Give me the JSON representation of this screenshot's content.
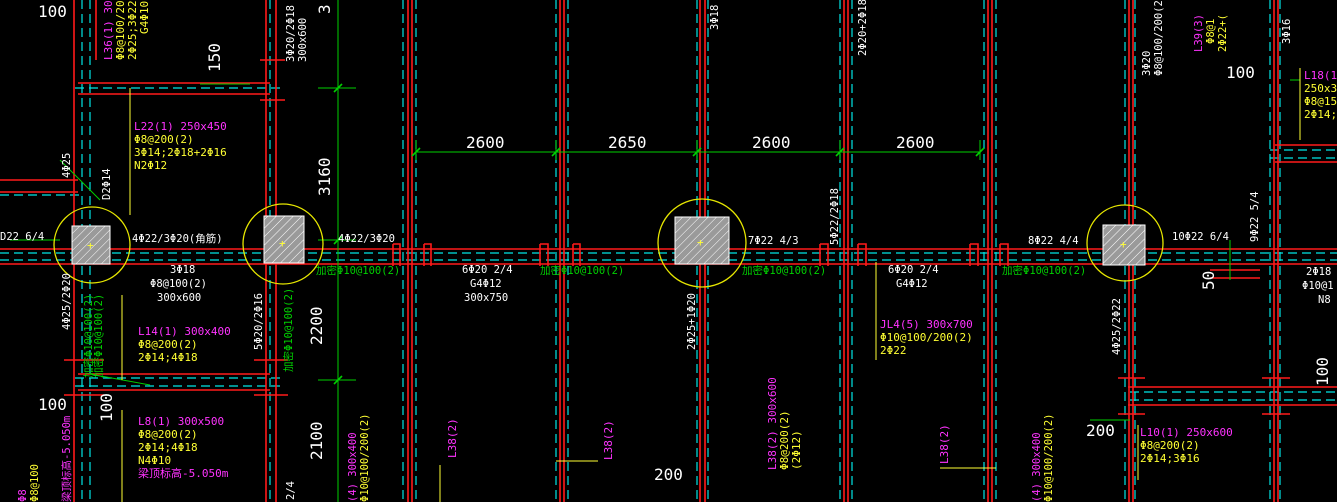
{
  "palette": {
    "background": "#000000",
    "beam_red": "#ff1a1a",
    "axis_cyan": "#00e5e5",
    "dim_green": "#00d000",
    "text_white": "#ffffff",
    "text_yellow": "#ffff33",
    "text_magenta": "#ff33ff",
    "circle_yellow": "#e6e600",
    "column_fill": "#bdbdbd"
  },
  "dimensions": {
    "d2600a": "2600",
    "d2650": "2650",
    "d2600b": "2600",
    "d2600c": "2600",
    "d3160": "3160",
    "d2200": "2200",
    "d2100": "2100",
    "d150": "150",
    "d100a": "100",
    "d100b": "100",
    "d100c": "100",
    "d100r1": "100",
    "d100r2": "100",
    "d200a": "200",
    "d200b": "200",
    "d50": "50",
    "d3": "3"
  },
  "beams": {
    "l22": {
      "title": "L22(1) 250x450",
      "l1": "Φ8@200(2)",
      "l2": "3Φ14;2Φ18+2Φ16",
      "l3": "N2Φ12"
    },
    "l14": {
      "title": "L14(1) 300x400",
      "l1": "Φ8@200(2)",
      "l2": "2Φ14;4Φ18"
    },
    "l8": {
      "title": "L8(1) 300x500",
      "l1": "Φ8@200(2)",
      "l2": "2Φ14;4Φ18",
      "l3": "N4Φ10",
      "l4": "梁顶标高-5.050m"
    },
    "l36": {
      "title": "L36(1) 300",
      "l1": "Φ8@100/200",
      "l2": "2Φ25;3Φ22",
      "l3": "G4Φ10"
    },
    "jl4": {
      "title": "JL4(5) 300x700",
      "l1": "Φ10@100/200(2)",
      "l2": "2Φ22"
    },
    "l10": {
      "title": "L10(1) 250x600",
      "l1": "Φ8@200(2)",
      "l2": "2Φ14;3Φ16"
    },
    "l18": {
      "title": "L18(1)",
      "l1": "250x3",
      "l2": "Φ8@15",
      "l3": "2Φ14;2"
    },
    "l38s": {
      "title": "L38(2) 300x600",
      "l1": "Φ8@200(2)",
      "l2": "(2Φ12)"
    },
    "l38a": "L38(2)",
    "l38b": "L38(2)",
    "l38c": "L38(2)"
  },
  "rebar": {
    "a1": "D2Φ14",
    "a2": "4Φ25",
    "a3": "4Φ25/2Φ20",
    "a4": "4Φ22/3Φ20(角筋)",
    "a5": "3Φ18",
    "a6": "Φ8@100(2)",
    "a7": "300x600",
    "a8": "4Φ22/3Φ20",
    "a9": "5Φ20/2Φ16",
    "a10": "3Φ20/2Φ18",
    "a11": "300x600",
    "a12": "6Φ20 2/4",
    "a13": "G4Φ12",
    "a14": "300x750",
    "a15": "7Φ22 4/3",
    "a16": "6Φ20 2/4",
    "a17": "G4Φ12",
    "a18": "8Φ22 4/4",
    "a19": "10Φ22 6/4",
    "a20": "9Φ22 5/4",
    "a21": "2Φ25+1Φ20",
    "a22": "4Φ25/2Φ22",
    "a23": "5Φ22/2Φ18",
    "a24": "2Φ20+2Φ18",
    "a25": "3Φ18",
    "a26": "D22 6/4",
    "s1": "加密Φ10@100(2)",
    "s2": "加密Φ10@100(2)",
    "s3": "加密Φ10@100(2)",
    "s4": "加密Φ10@100(2)",
    "s5": "加密Φ10@100(2)",
    "s6": "加密Φ10@100(2)",
    "s7": "加密Φ10@100(2)",
    "s8": "加密Φ10@100(2)",
    "r1": "3Φ20",
    "r2": "Φ8@100/200(2)",
    "r3": "L39(3)",
    "r4": "Φ8@1",
    "r5": "2Φ22+(",
    "r6": "3Φ16",
    "r7": "2Φ18",
    "r8": "Φ10@1",
    "r9": "N8",
    "b1": "(4) 300x400",
    "b2": "Φ10@100/200(2)",
    "b3": "(4) 300x400",
    "b4": "Φ10@100/200(2)",
    "b5": "Φ8@100",
    "b6": "Φ8",
    "b7": "梁顶标高-5.050m",
    "b8": "2/4"
  }
}
